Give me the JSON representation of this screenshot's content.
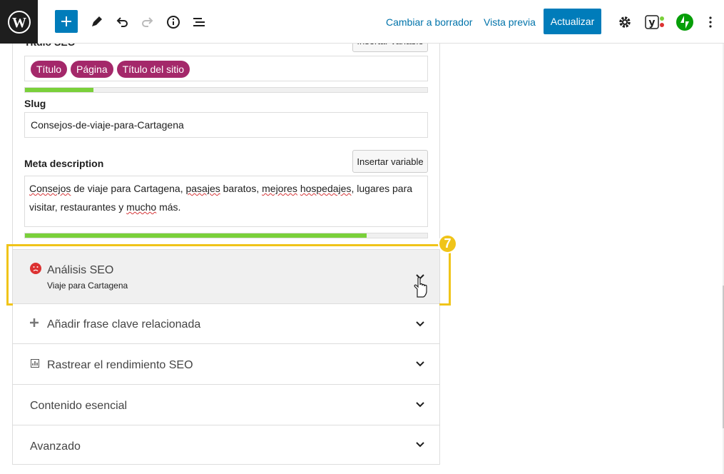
{
  "toolbar": {
    "switch_draft": "Cambiar a borrador",
    "preview": "Vista previa",
    "update": "Actualizar"
  },
  "seo": {
    "title_label": "Título SEO",
    "insert_variable_top": "Insertar variable",
    "title_pills": [
      "Título",
      "Página",
      "Título del sitio"
    ],
    "title_progress": 0.17,
    "slug_label": "Slug",
    "slug_value": "Consejos-de-viaje-para-Cartagena",
    "meta_label": "Meta description",
    "insert_variable": "Insertar variable",
    "meta_words": [
      {
        "t": "Consejos",
        "sq": true
      },
      {
        "t": " de viaje para Cartagena, ",
        "sq": false
      },
      {
        "t": "pasajes",
        "sq": true
      },
      {
        "t": " baratos, ",
        "sq": false
      },
      {
        "t": "mejores",
        "sq": true
      },
      {
        "t": " ",
        "sq": false
      },
      {
        "t": "hospedajes",
        "sq": true
      },
      {
        "t": ", lugares para visitar, restaurantes y ",
        "sq": false
      },
      {
        "t": "mucho",
        "sq": true
      },
      {
        "t": " más.",
        "sq": false
      }
    ],
    "meta_progress": 0.85
  },
  "analysis": {
    "title": "Análisis SEO",
    "keyphrase": "Viaje para Cartagena",
    "step_badge": "7"
  },
  "panels": {
    "related": "Añadir frase clave relacionada",
    "track": "Rastrear el rendimiento SEO",
    "cornerstone": "Contenido esencial",
    "advanced": "Avanzado"
  },
  "colors": {
    "accent": "#007cba",
    "pill": "#a4286a",
    "progress_good": "#7ad03a",
    "highlight": "#f0c419",
    "bad": "#dc3232",
    "jetpack": "#069e08"
  }
}
